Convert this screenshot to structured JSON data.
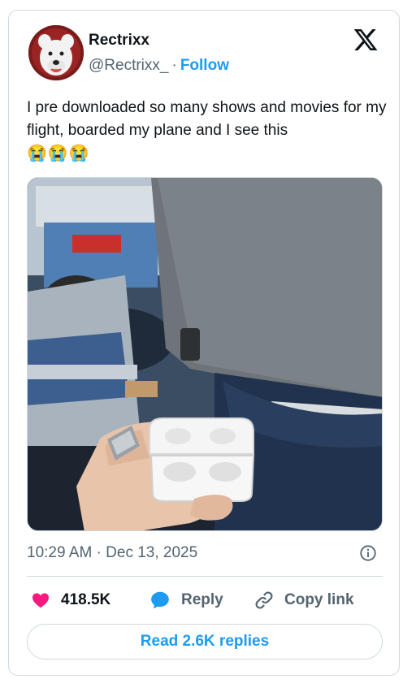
{
  "author": {
    "name": "Rectrixx",
    "handle": "@Rectrixx_",
    "separator": "·",
    "follow_label": "Follow"
  },
  "tweet": {
    "text": "I pre downloaded so many shows and movies for my flight, boarded my plane and I see this",
    "emojis": "😭😭😭",
    "timestamp": "10:29 AM · Dec 13, 2025"
  },
  "actions": {
    "like_count": "418.5K",
    "reply_label": "Reply",
    "copy_label": "Copy link"
  },
  "read_replies_label": "Read 2.6K replies",
  "icons": {
    "logo": "x-logo-icon",
    "info": "info-icon",
    "like": "heart-icon",
    "reply": "speech-bubble-icon",
    "copy": "link-icon"
  },
  "colors": {
    "accent": "#1d9bf0",
    "like": "#f91880",
    "secondary_text": "#536471",
    "border": "#cfd9de"
  }
}
